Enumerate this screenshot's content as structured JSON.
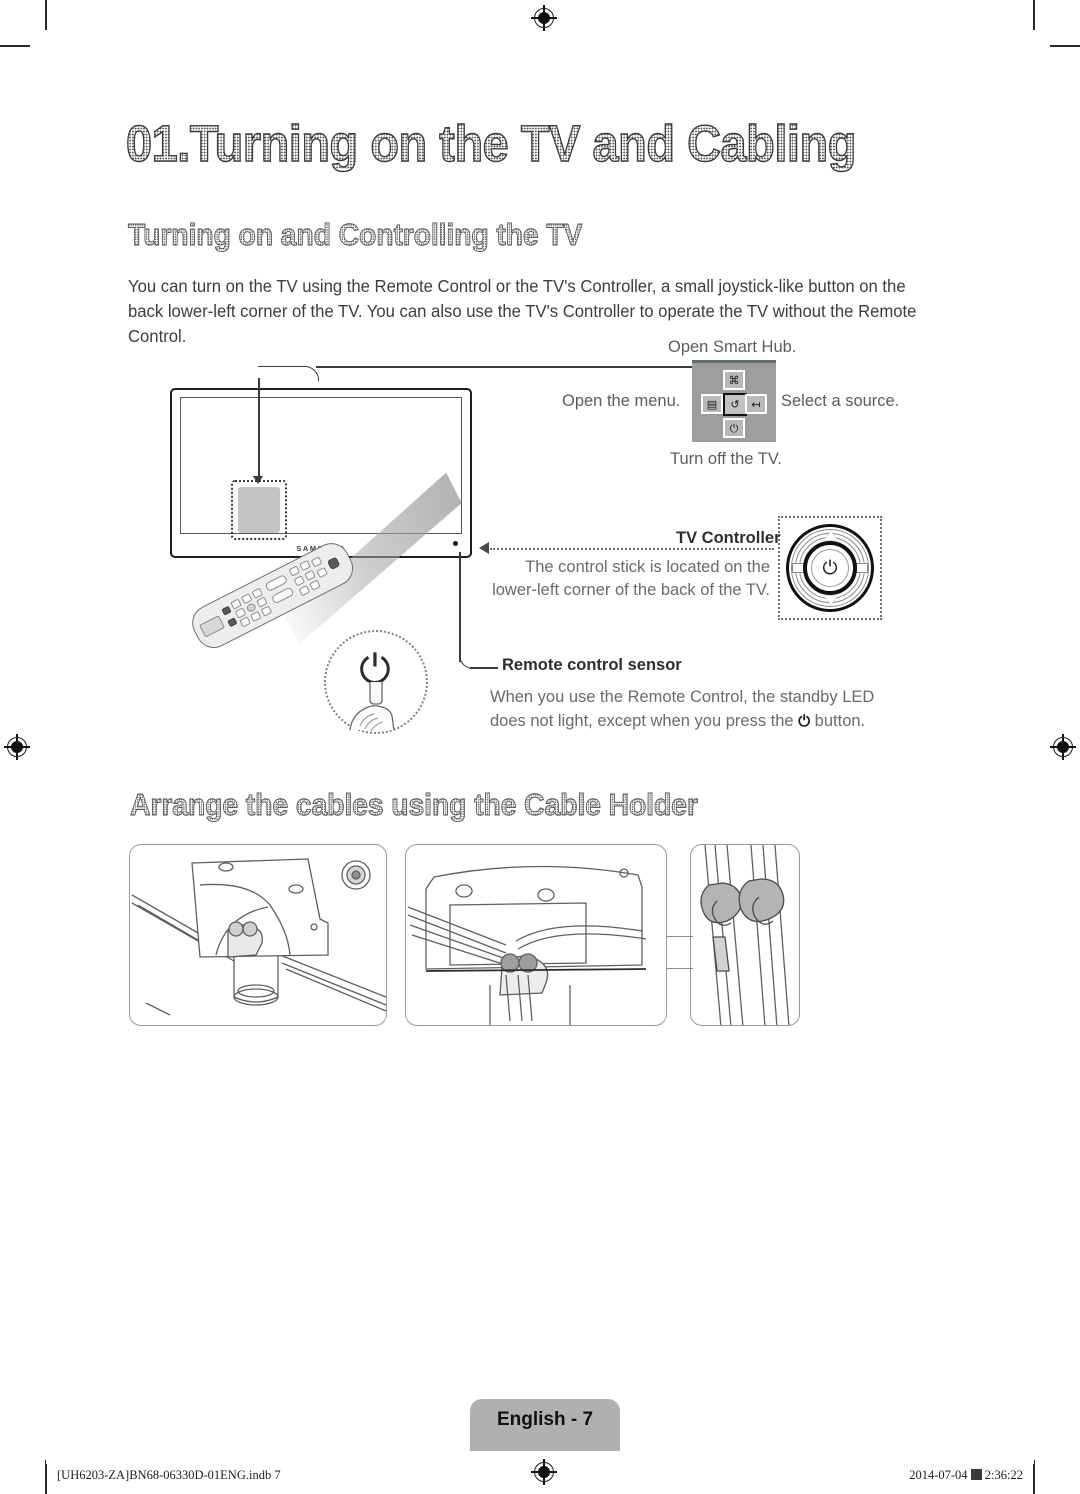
{
  "document": {
    "chapter_title": "01.Turning on the TV and Cabling",
    "section_1_heading": "Turning on and Controlling the TV",
    "section_1_body": "You can turn on the TV using the Remote Control or the TV's Controller, a small joystick-like button on the back lower-left corner of the TV. You can also use the TV's Controller to operate the TV without the Remote Control.",
    "section_2_heading": "Arrange the cables using the Cable Holder"
  },
  "tv_illustration": {
    "brand_logo": "SAMSUNG"
  },
  "controller_panel": {
    "label_top": "Open Smart Hub.",
    "label_left": "Open the menu.",
    "label_right": "Select a source.",
    "label_bottom": "Turn off the TV.",
    "buttons": {
      "smart_hub_icon": "smart-hub-icon",
      "menu_icon": "menu-icon",
      "return_icon": "return-icon",
      "source_icon": "source-icon",
      "power_icon": "power-icon"
    },
    "button_glyphs": {
      "smart_hub": "⌘",
      "menu": "▤",
      "return": "↺",
      "source": "↤",
      "power": "⏻"
    }
  },
  "tv_controller": {
    "title": "TV Controller",
    "description": "The control stick is located on the lower-left corner of the back of the TV.",
    "joystick_icon": "power-icon",
    "joystick_glyph": "⏻"
  },
  "remote_sensor": {
    "title": "Remote control sensor",
    "description_before": "When you use the Remote Control, the standby LED does not light, except when you press the",
    "power_glyph": "⏻",
    "description_after": "button."
  },
  "cable_panels": [
    {
      "name": "cable-holder-closeup"
    },
    {
      "name": "cables-routed-through-holder"
    },
    {
      "name": "cable-holder-zoom-detail"
    }
  ],
  "footer": {
    "page_label": "English - 7",
    "file_reference": "[UH6203-ZA]BN68-06330D-01ENG.indb   7",
    "date": "2014-07-04",
    "time_marker": "■",
    "time": "2:36:22"
  },
  "colors": {
    "heading_gray": "#5a5a5a",
    "body_gray": "#3d3d3d",
    "caption_gray": "#6a6a6a",
    "panel_gray": "#9e9e9e",
    "tab_gray": "#b0b0b0",
    "accent_dark": "#1d1d1d"
  }
}
